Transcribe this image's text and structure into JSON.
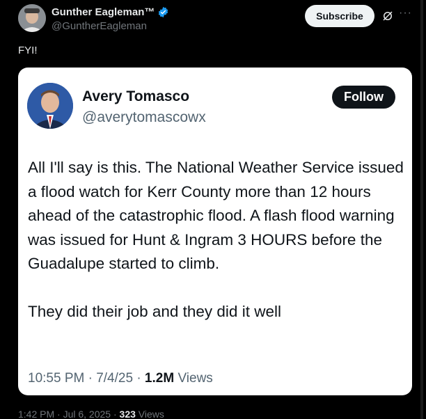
{
  "author": {
    "name": "Gunther Eagleman™",
    "handle": "@GuntherEagleman",
    "verified_color": "#1d9bf0"
  },
  "actions": {
    "subscribe_label": "Subscribe",
    "grok_icon": "grok-icon",
    "more_icon": "more-icon"
  },
  "post": {
    "text": "FYI!",
    "date": "1:42 PM · Jul 6, 2025 · ",
    "views_count": "323",
    "views_label": " Views"
  },
  "quoted": {
    "name": "Avery Tomasco",
    "handle": "@averytomascowx",
    "follow_label": "Follow",
    "paragraph1": "All I'll say is this. The National Weather Service issued a flood watch for Kerr County more than 12 hours ahead of the catastrophic flood. A flash flood warning was issued for Hunt & Ingram 3 HOURS before the Guadalupe started to climb.",
    "paragraph2": "They did their job and they did it well",
    "meta_prefix": "10:55 PM · 7/4/25 · ",
    "views_count": "1.2M",
    "views_label": " Views"
  }
}
